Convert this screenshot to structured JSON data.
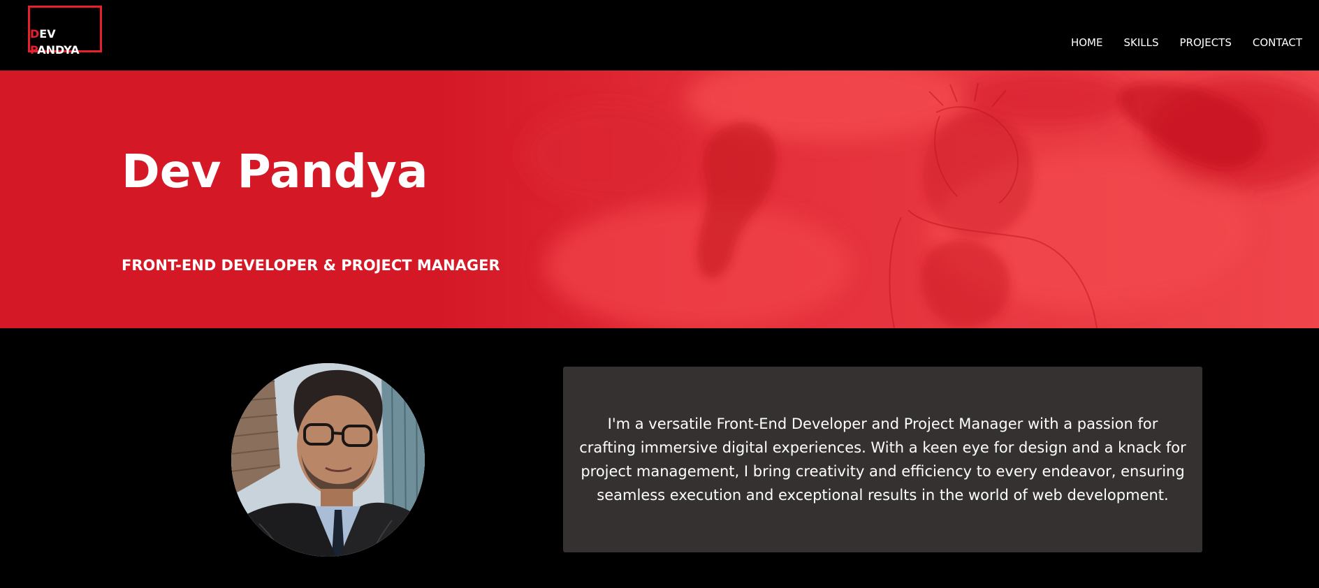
{
  "brand": {
    "line1_initial": "D",
    "line1_rest": "EV",
    "line2_initial": "P",
    "line2_rest": "ANDYA",
    "accent_color": "#e8202c"
  },
  "nav": {
    "items": [
      {
        "label": "HOME"
      },
      {
        "label": "SKILLS"
      },
      {
        "label": "PROJECTS"
      },
      {
        "label": "CONTACT"
      }
    ]
  },
  "hero": {
    "title": "Dev Pandya",
    "subtitle": "FRONT-END DEVELOPER & PROJECT MANAGER",
    "background_color": "#d41826",
    "background_image": "red-watercolor-figure-illustration"
  },
  "about": {
    "avatar": "profile-photo",
    "bio": "I'm a versatile Front-End Developer and Project Manager with a passion for crafting immersive digital experiences. With a keen eye for design and a knack for project management, I bring creativity and efficiency to every endeavor, ensuring seamless execution and exceptional results in the world of web development.",
    "card_color": "#343130"
  }
}
